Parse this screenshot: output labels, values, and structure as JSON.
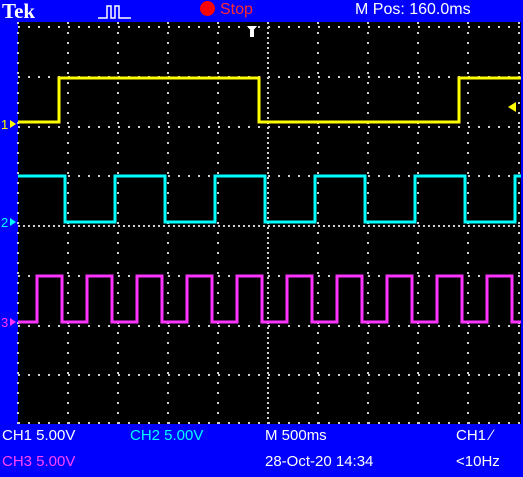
{
  "header": {
    "brand": "Tek",
    "trigger_state_icon": "pulse-trigger-icon",
    "acquisition_state": "Stop",
    "position_readout": "M Pos: 160.0ms"
  },
  "channels": [
    {
      "id": "1",
      "color": "#ffff00"
    },
    {
      "id": "2",
      "color": "#00ffff"
    },
    {
      "id": "3",
      "color": "#ff33ff"
    }
  ],
  "footer": {
    "ch1_scale": "CH1  5.00V",
    "ch2_scale": "CH2  5.00V",
    "timebase": "M 500ms",
    "trigger": "CH1 ∕",
    "ch3_scale": "CH3  5.00V",
    "datetime": "28-Oct-20 14:34",
    "frequency": "<10Hz"
  },
  "colors": {
    "screen_bg": "#000000",
    "frame_bg": "#0000ff",
    "grid": "#cfcfcf"
  }
}
